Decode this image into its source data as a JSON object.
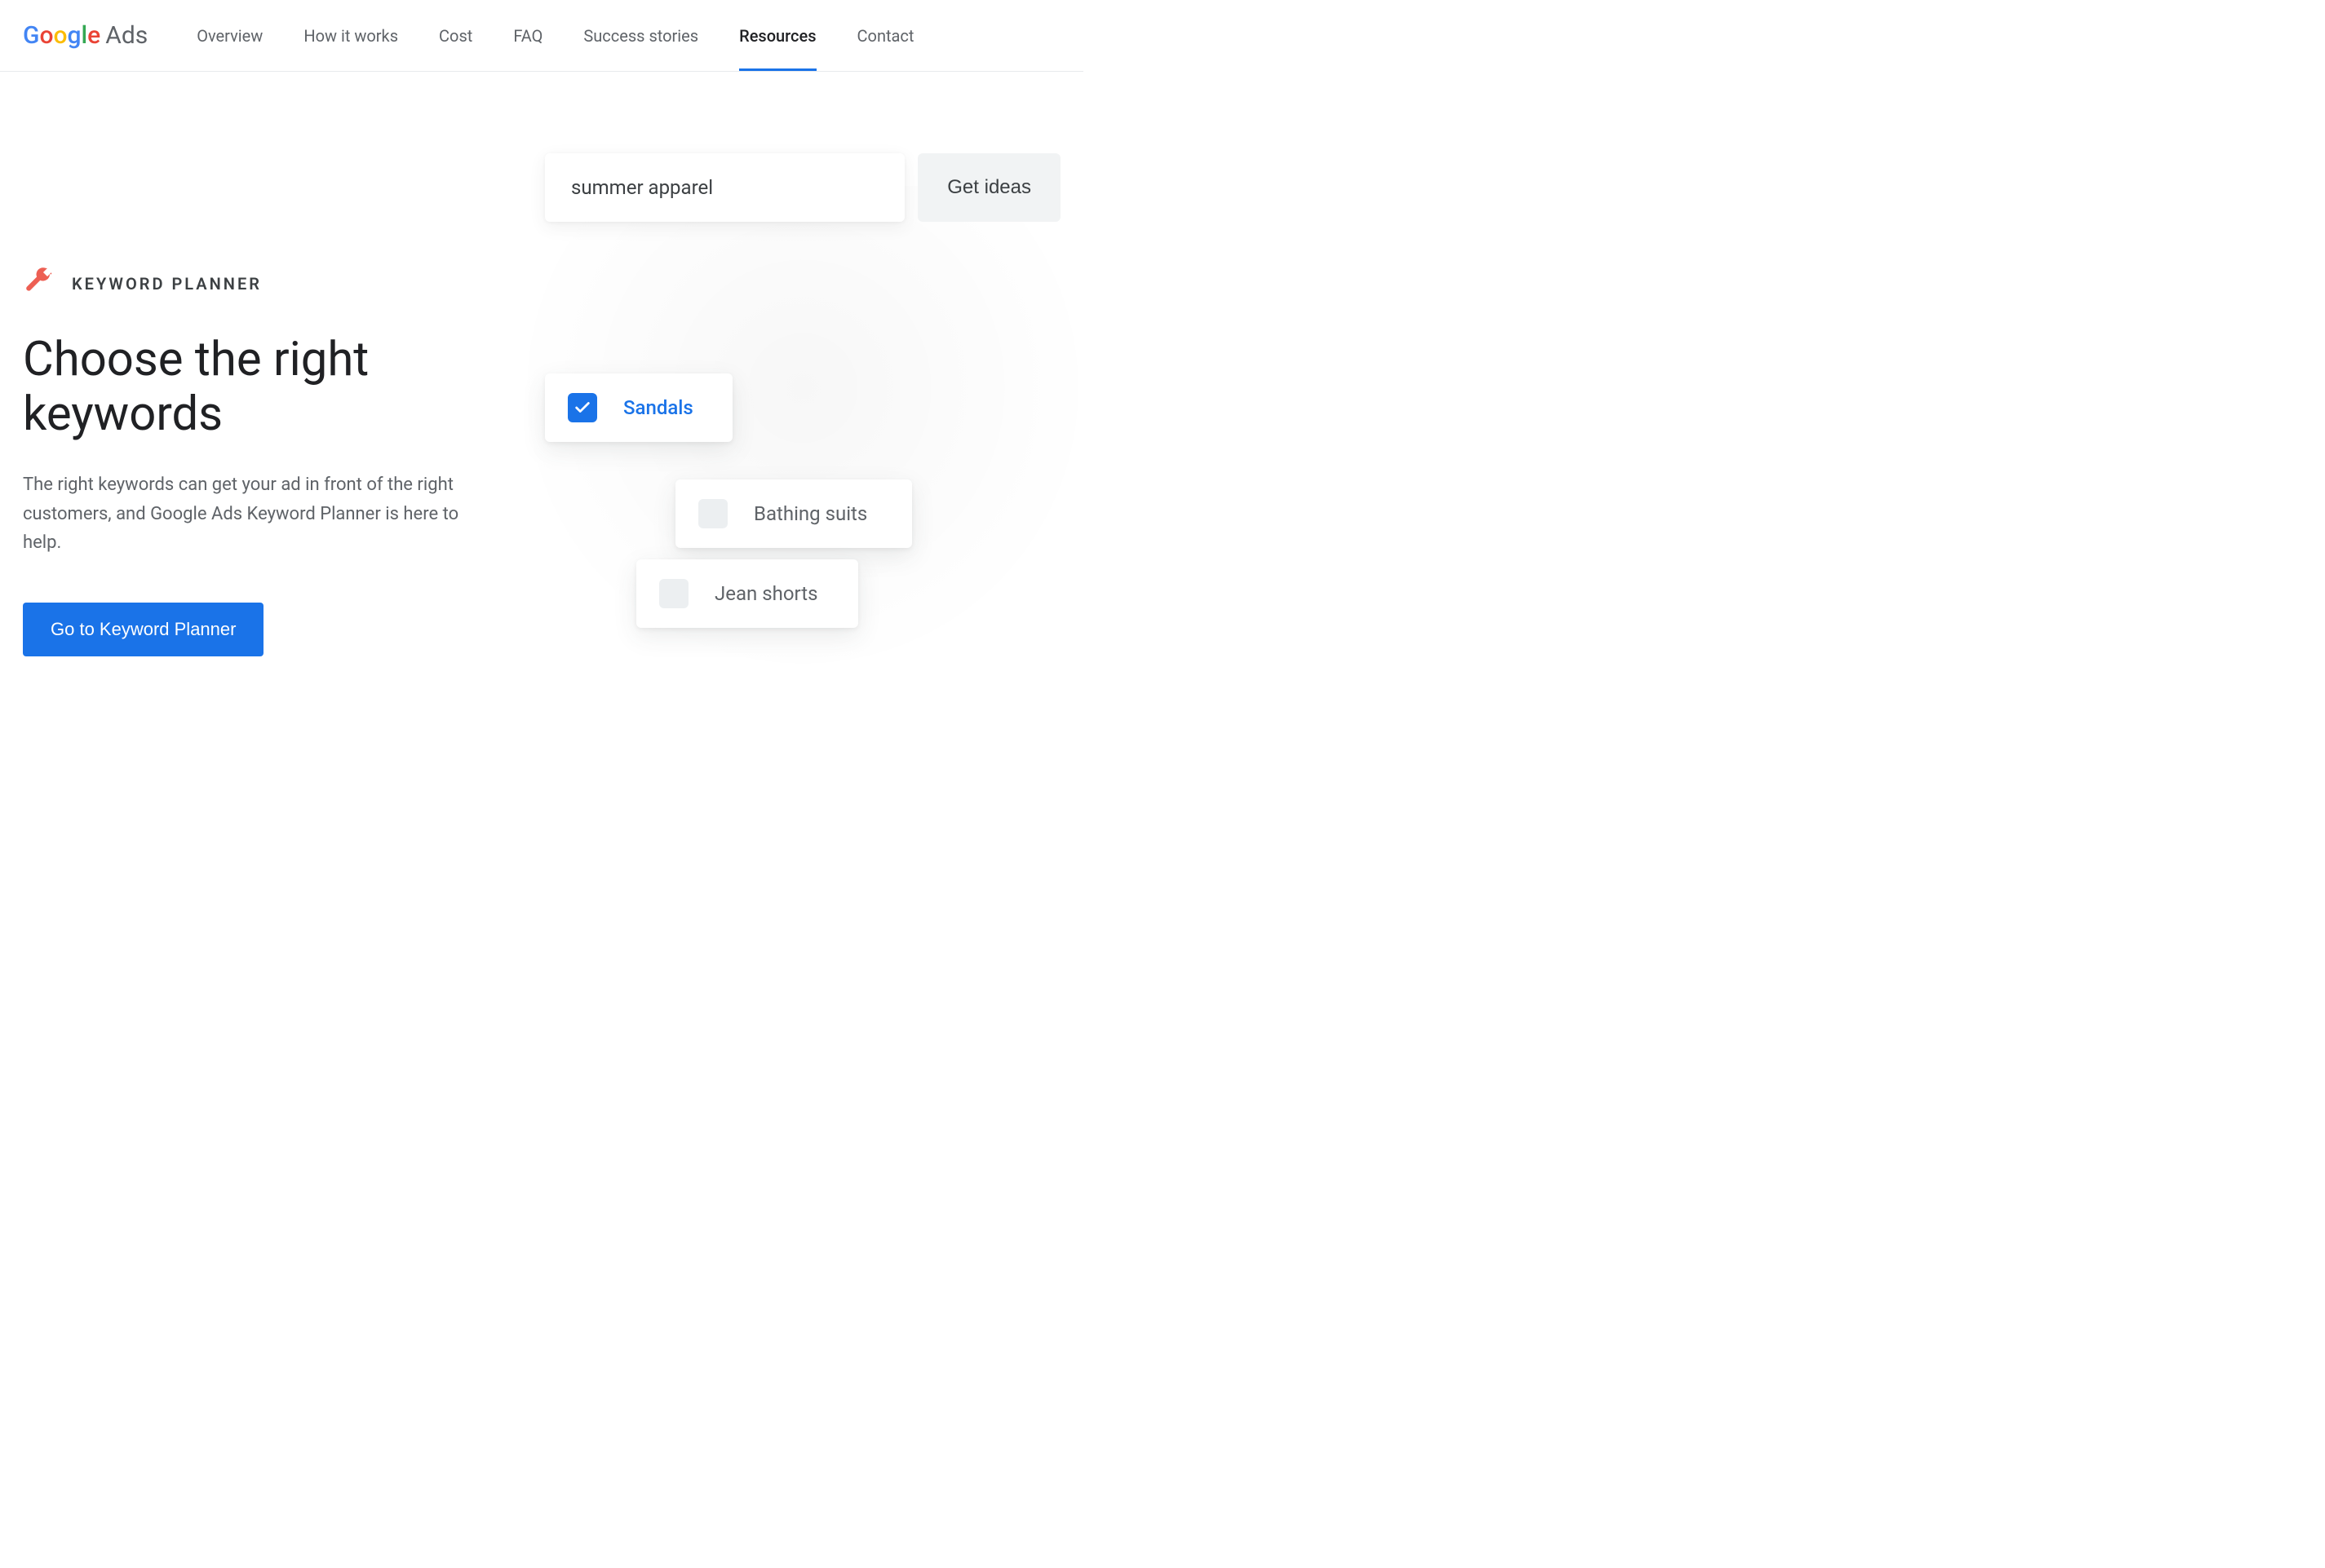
{
  "header": {
    "logo_text": "Google",
    "logo_suffix": "Ads",
    "nav": [
      {
        "label": "Overview",
        "active": false
      },
      {
        "label": "How it works",
        "active": false
      },
      {
        "label": "Cost",
        "active": false
      },
      {
        "label": "FAQ",
        "active": false
      },
      {
        "label": "Success stories",
        "active": false
      },
      {
        "label": "Resources",
        "active": true
      },
      {
        "label": "Contact",
        "active": false
      }
    ]
  },
  "hero": {
    "eyebrow": "KEYWORD PLANNER",
    "headline": "Choose the right keywords",
    "subtext": "The right keywords can get your ad in front of the right customers, and Google Ads Keyword Planner is here to help.",
    "cta": "Go to Keyword Planner"
  },
  "illustration": {
    "search_value": "summer apparel",
    "get_ideas_label": "Get ideas",
    "keywords": [
      {
        "label": "Sandals",
        "checked": true
      },
      {
        "label": "Bathing suits",
        "checked": false
      },
      {
        "label": "Jean shorts",
        "checked": false
      }
    ]
  }
}
